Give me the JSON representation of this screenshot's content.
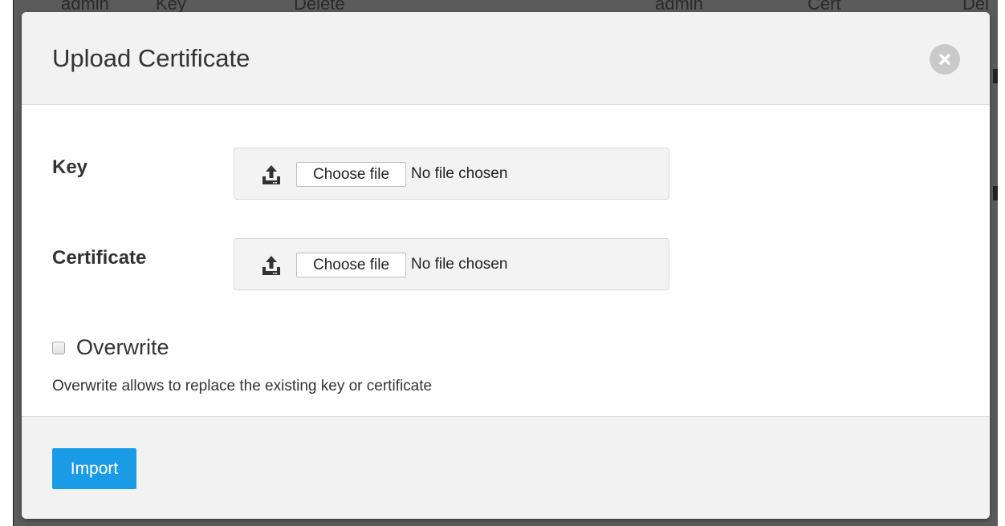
{
  "background_table": {
    "cells": [
      "admin",
      "Key",
      "Delete",
      "admin",
      "Cert",
      "Del"
    ]
  },
  "modal": {
    "title": "Upload Certificate",
    "close_icon": "close-icon"
  },
  "form": {
    "key_label": "Key",
    "certificate_label": "Certificate",
    "key_file": {
      "button_label": "Choose file",
      "status": "No file chosen",
      "icon": "upload-icon"
    },
    "certificate_file": {
      "button_label": "Choose file",
      "status": "No file chosen",
      "icon": "upload-icon"
    },
    "overwrite_label": "Overwrite",
    "overwrite_checked": false,
    "help_text": "Overwrite allows to replace the existing key or certificate"
  },
  "footer": {
    "import_label": "Import"
  },
  "colors": {
    "primary": "#1a9be6",
    "header_bg": "#f2f2f2",
    "backdrop": "#5b5b5b"
  }
}
